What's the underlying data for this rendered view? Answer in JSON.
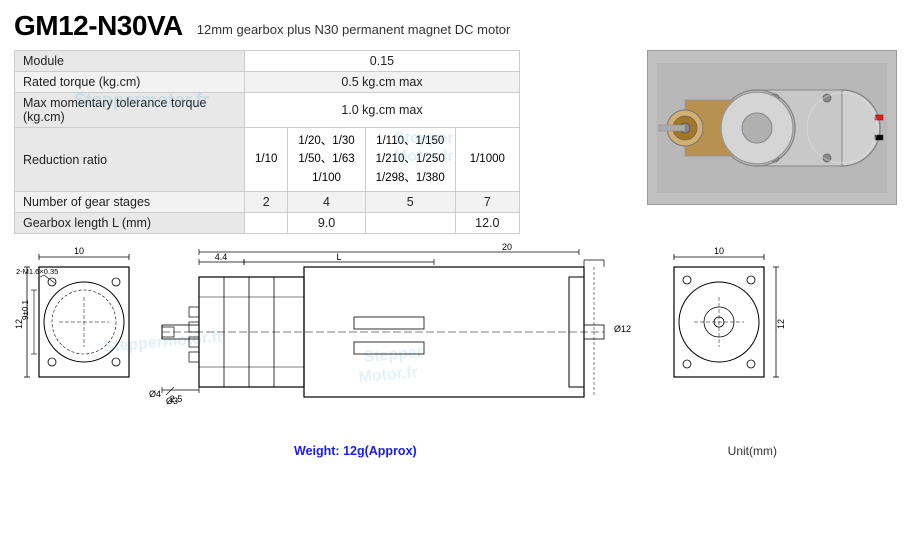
{
  "header": {
    "model": "GM12-N30VA",
    "subtitle": "12mm gearbox plus N30 permanent magnet DC  motor"
  },
  "specs": {
    "rows": [
      {
        "label": "Module",
        "value": "0.15",
        "shaded": false
      },
      {
        "label": "Rated torque (kg.cm)",
        "value": "0.5 kg.cm max",
        "shaded": true
      },
      {
        "label": "Max momentary tolerance torque (kg.cm)",
        "value": "1.0 kg.cm max",
        "shaded": false
      }
    ],
    "reduction_ratio": {
      "label": "Reduction ratio",
      "columns": [
        {
          "value": "1/10"
        },
        {
          "value": "1/20、1/30\n1/50、1/63\n1/100"
        },
        {
          "value": "1/110、1/150\n1/210、1/250\n1/298、1/380"
        },
        {
          "value": "1/1000"
        }
      ]
    },
    "gear_stages": {
      "label": "Number of gear stages",
      "columns": [
        "2",
        "4",
        "5",
        "7"
      ]
    },
    "gearbox_length": {
      "label": "Gearbox length  L (mm)",
      "columns": [
        "",
        "9.0",
        "",
        "12.0"
      ]
    }
  },
  "weight": "Weight: 12g(Approx)",
  "unit": "Unit(mm)",
  "diagrams": {
    "front_view": {
      "width_label": "10",
      "height_label": "12",
      "hole_label": "2-M1.6×0.35",
      "inner_dim": "9±0.1"
    },
    "side_view": {
      "dim1": "4.4",
      "dim2": "L",
      "dim3": "20",
      "shaft_dia": "Ø4",
      "shaft2": "Ø3",
      "shaft_len": "2.5",
      "body_dia": "Ø12"
    },
    "rear_view": {
      "width_label": "10",
      "height_label": "12"
    }
  },
  "watermarks": [
    "Steppermotor.fr",
    "Stepper",
    "Motor.fr",
    "Stepper",
    "Motor.fr"
  ]
}
